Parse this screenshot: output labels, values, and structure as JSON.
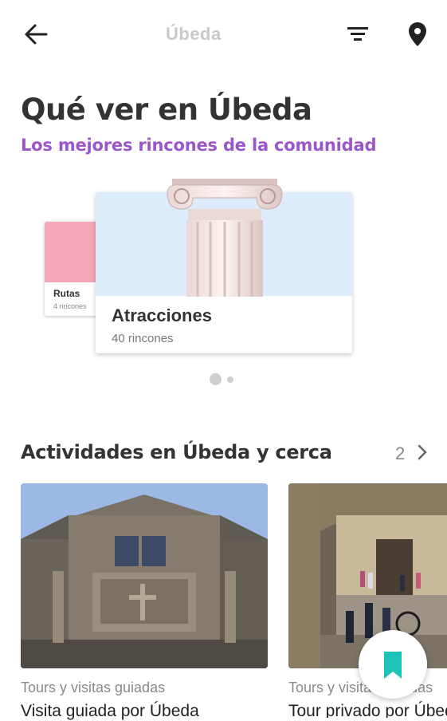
{
  "header": {
    "title": "Úbeda",
    "back_icon": "arrow-left-icon",
    "filter_icon": "filter-icon",
    "map_icon": "map-pin-icon"
  },
  "hero": {
    "title": "Qué ver en Úbeda",
    "subtitle": "Los mejores rincones de la comunidad",
    "subtitle_color": "#9c56c9"
  },
  "carousel": {
    "cards": [
      {
        "title": "Rutas",
        "count": "4 rincones",
        "color": "#f5a7b7"
      },
      {
        "title": "Atracciones",
        "count": "40 rincones",
        "color": "#dcecfb"
      }
    ],
    "active_index": 1
  },
  "activities": {
    "title": "Actividades en Úbeda y cerca",
    "count": "2",
    "items": [
      {
        "category": "Tours y visitas guiadas",
        "name": "Visita guiada por Úbeda"
      },
      {
        "category": "Tours y visitas guiadas",
        "name": "Tour privado por Úbeda"
      }
    ]
  },
  "fab": {
    "icon": "bookmark-icon",
    "color": "#1fc2b6"
  }
}
